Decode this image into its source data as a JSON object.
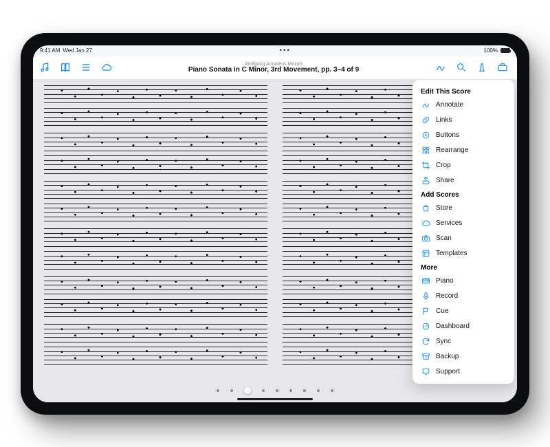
{
  "status": {
    "time": "9:41 AM",
    "date": "Wed Jan 27",
    "battery": "100%"
  },
  "toolbar": {
    "composer": "Wolfgang Amadeus Mozart",
    "title": "Piano Sonata in C Minor, 3rd Movement, pp. 3–4 of 9"
  },
  "popover": {
    "section_edit": "Edit This Score",
    "edit_items": [
      {
        "key": "annotate",
        "label": "Annotate",
        "icon": "pencil"
      },
      {
        "key": "links",
        "label": "Links",
        "icon": "link"
      },
      {
        "key": "buttons",
        "label": "Buttons",
        "icon": "circle-play"
      },
      {
        "key": "rearrange",
        "label": "Rearrange",
        "icon": "grid"
      },
      {
        "key": "crop",
        "label": "Crop",
        "icon": "crop"
      },
      {
        "key": "share",
        "label": "Share",
        "icon": "share"
      }
    ],
    "section_add": "Add Scores",
    "add_items": [
      {
        "key": "store",
        "label": "Store",
        "icon": "bag"
      },
      {
        "key": "services",
        "label": "Services",
        "icon": "cloud"
      },
      {
        "key": "scan",
        "label": "Scan",
        "icon": "camera"
      },
      {
        "key": "templates",
        "label": "Templates",
        "icon": "templates"
      }
    ],
    "section_more": "More",
    "more_items": [
      {
        "key": "piano",
        "label": "Piano",
        "icon": "piano"
      },
      {
        "key": "record",
        "label": "Record",
        "icon": "mic"
      },
      {
        "key": "cue",
        "label": "Cue",
        "icon": "flag"
      },
      {
        "key": "dashboard",
        "label": "Dashboard",
        "icon": "gauge"
      },
      {
        "key": "sync",
        "label": "Sync",
        "icon": "sync"
      },
      {
        "key": "backup",
        "label": "Backup",
        "icon": "archive"
      },
      {
        "key": "support",
        "label": "Support",
        "icon": "chat"
      }
    ]
  },
  "pager": {
    "total": 9,
    "current": 3
  },
  "colors": {
    "accent": "#0a84ff"
  }
}
